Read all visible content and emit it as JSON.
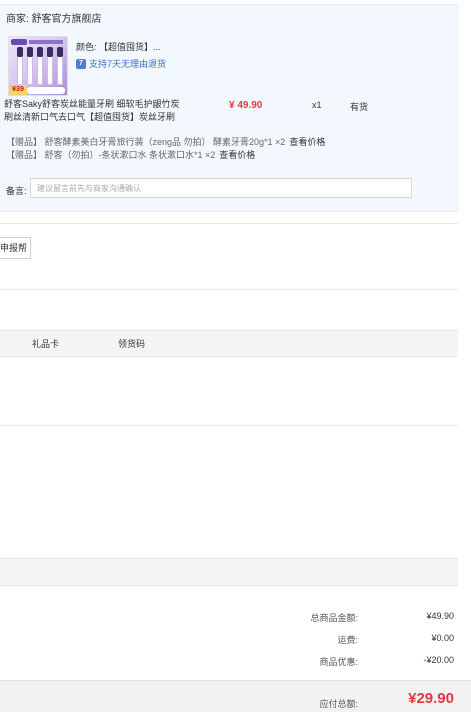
{
  "shop": {
    "label": "商家: 舒客官方旗舰店"
  },
  "product": {
    "thumb_price": "¥39",
    "color": "颜色: 【超值囤货】...",
    "return_policy": "支持7天无理由退货",
    "name": "舒客Saky舒客炭丝能量牙刷 细软毛护龈竹炭刷丝清新口气去口气【超值囤货】炭丝牙刷",
    "unit_price": "¥ 49.90",
    "quantity": "x1",
    "stock": "有货"
  },
  "gifts": [
    {
      "text": "【赠品】 舒客酵素美白牙膏旅行装（zeng品 勿拍） 酵素牙膏20g*1 ×2",
      "view_label": "查看价格"
    },
    {
      "text": "【赠品】 舒客（勿拍）-条状漱口水 条状漱口水*1 ×2",
      "view_label": "查看价格"
    }
  ],
  "remark": {
    "label": "备言:",
    "placeholder": "建议留言前先与商家沟通确认"
  },
  "invoice": {
    "apply_label": "申报帮"
  },
  "tabs": {
    "gift_card": "礼品卡",
    "coupon_code": "领货码"
  },
  "summary": {
    "goods_total_label": "总商品金额:",
    "goods_total_value": "¥49.90",
    "shipping_label": "运费:",
    "shipping_value": "¥0.00",
    "discount_label": "商品优惠:",
    "discount_value": "-¥20.00",
    "payable_label": "应付总额:",
    "payable_value": "¥29.90"
  },
  "colors": {
    "price_red": "#e4393c",
    "link_blue": "#3a6fc7",
    "order_bg": "#f3f8fe"
  }
}
